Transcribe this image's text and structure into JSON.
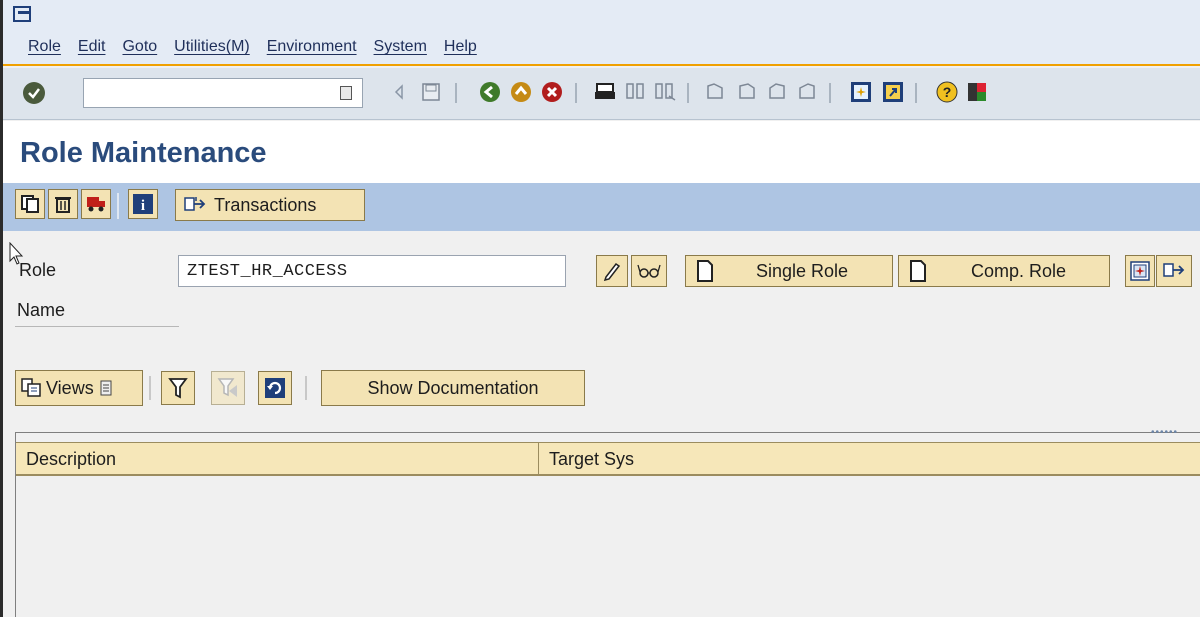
{
  "menu": {
    "items": [
      "Role",
      "Edit",
      "Goto",
      "Utilities(M)",
      "Environment",
      "System",
      "Help"
    ]
  },
  "system_toolbar": {
    "command_field_value": "",
    "icons": [
      "enter-icon",
      "back-icon",
      "save-icon",
      "green-back-icon",
      "exit-icon",
      "cancel-icon",
      "print-icon",
      "find-icon",
      "find-next-icon",
      "first-page-icon",
      "previous-page-icon",
      "next-page-icon",
      "last-page-icon",
      "create-session-icon",
      "shortcut-icon",
      "help-icon",
      "layout-menu-icon"
    ]
  },
  "page": {
    "title": "Role Maintenance"
  },
  "app_toolbar": {
    "transactions_label": "Transactions"
  },
  "form": {
    "role_label": "Role",
    "role_value": "ZTEST_HR_ACCESS",
    "name_label": "Name",
    "single_role_label": "Single Role",
    "comp_role_label": "Comp. Role"
  },
  "views_toolbar": {
    "views_label": "Views",
    "show_documentation_label": "Show Documentation"
  },
  "table": {
    "columns": [
      "Description",
      "Target Sys"
    ]
  },
  "colors": {
    "menubar_bg": "#e4ebf5",
    "app_toolbar_bg": "#aec5e3",
    "button_bg": "#f3e3b4",
    "title_color": "#2a4b7c",
    "accent_line": "#f0a000"
  }
}
